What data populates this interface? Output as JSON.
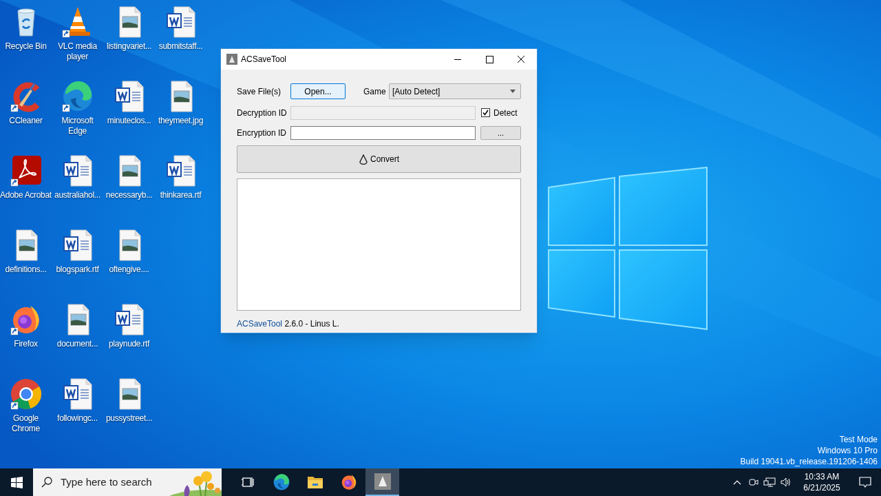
{
  "desktop": {
    "icons": [
      {
        "label": "Recycle Bin",
        "kind": "recycle-bin",
        "shortcut": false
      },
      {
        "label": "CCleaner",
        "kind": "ccleaner",
        "shortcut": true
      },
      {
        "label": "Adobe Acrobat",
        "kind": "acrobat",
        "shortcut": true
      },
      {
        "label": "definitions...",
        "kind": "image-file",
        "shortcut": false
      },
      {
        "label": "Firefox",
        "kind": "firefox",
        "shortcut": true
      },
      {
        "label": "Google Chrome",
        "kind": "chrome",
        "shortcut": true
      },
      {
        "label": "VLC media player",
        "kind": "vlc",
        "shortcut": true
      },
      {
        "label": "Microsoft Edge",
        "kind": "edge",
        "shortcut": true
      },
      {
        "label": "australiahol...",
        "kind": "word-file",
        "shortcut": false
      },
      {
        "label": "blogspark.rtf",
        "kind": "word-file",
        "shortcut": false
      },
      {
        "label": "document...",
        "kind": "image-file",
        "shortcut": false
      },
      {
        "label": "followingc...",
        "kind": "word-file",
        "shortcut": false
      },
      {
        "label": "listingvariet...",
        "kind": "image-file",
        "shortcut": false
      },
      {
        "label": "minuteclos...",
        "kind": "word-file",
        "shortcut": false
      },
      {
        "label": "necessaryb...",
        "kind": "image-file",
        "shortcut": false
      },
      {
        "label": "oftengive....",
        "kind": "image-file",
        "shortcut": false
      },
      {
        "label": "playnude.rtf",
        "kind": "word-file",
        "shortcut": false
      },
      {
        "label": "pussystreet...",
        "kind": "image-file",
        "shortcut": false
      },
      {
        "label": "submitstaff...",
        "kind": "word-file",
        "shortcut": false
      },
      {
        "label": "theymeet.jpg",
        "kind": "image-file",
        "shortcut": false
      },
      {
        "label": "thinkarea.rtf",
        "kind": "word-file",
        "shortcut": false
      }
    ]
  },
  "window": {
    "title": "ACSaveTool",
    "save_files_label": "Save File(s)",
    "open_button": {
      "label": "Open...",
      "focused": true
    },
    "game_label": "Game",
    "game_select": {
      "value": "[Auto Detect]"
    },
    "decryption_label": "Decryption ID",
    "decryption_field": {
      "disabled": true
    },
    "detect_checkbox": {
      "label": "Detect",
      "checked": true
    },
    "encryption_label": "Encryption ID",
    "browse_button": "...",
    "convert_button": "Convert",
    "footer": {
      "link": "ACSaveTool",
      "text": "2.6.0 - Linus L."
    }
  },
  "watermark": [
    "Test Mode",
    "Windows 10 Pro",
    "Build 19041.vb_release.191206-1406"
  ],
  "taskbar": {
    "search": {
      "placeholder": "Type here to search"
    },
    "apps": [
      {
        "kind": "task-view",
        "selected": false
      },
      {
        "kind": "edge",
        "selected": false
      },
      {
        "kind": "folder",
        "selected": false
      },
      {
        "kind": "firefox",
        "selected": false
      },
      {
        "kind": "acsavetool",
        "selected": true
      }
    ],
    "clock": {
      "time": "10:33 AM",
      "date": "6/21/2025"
    }
  }
}
